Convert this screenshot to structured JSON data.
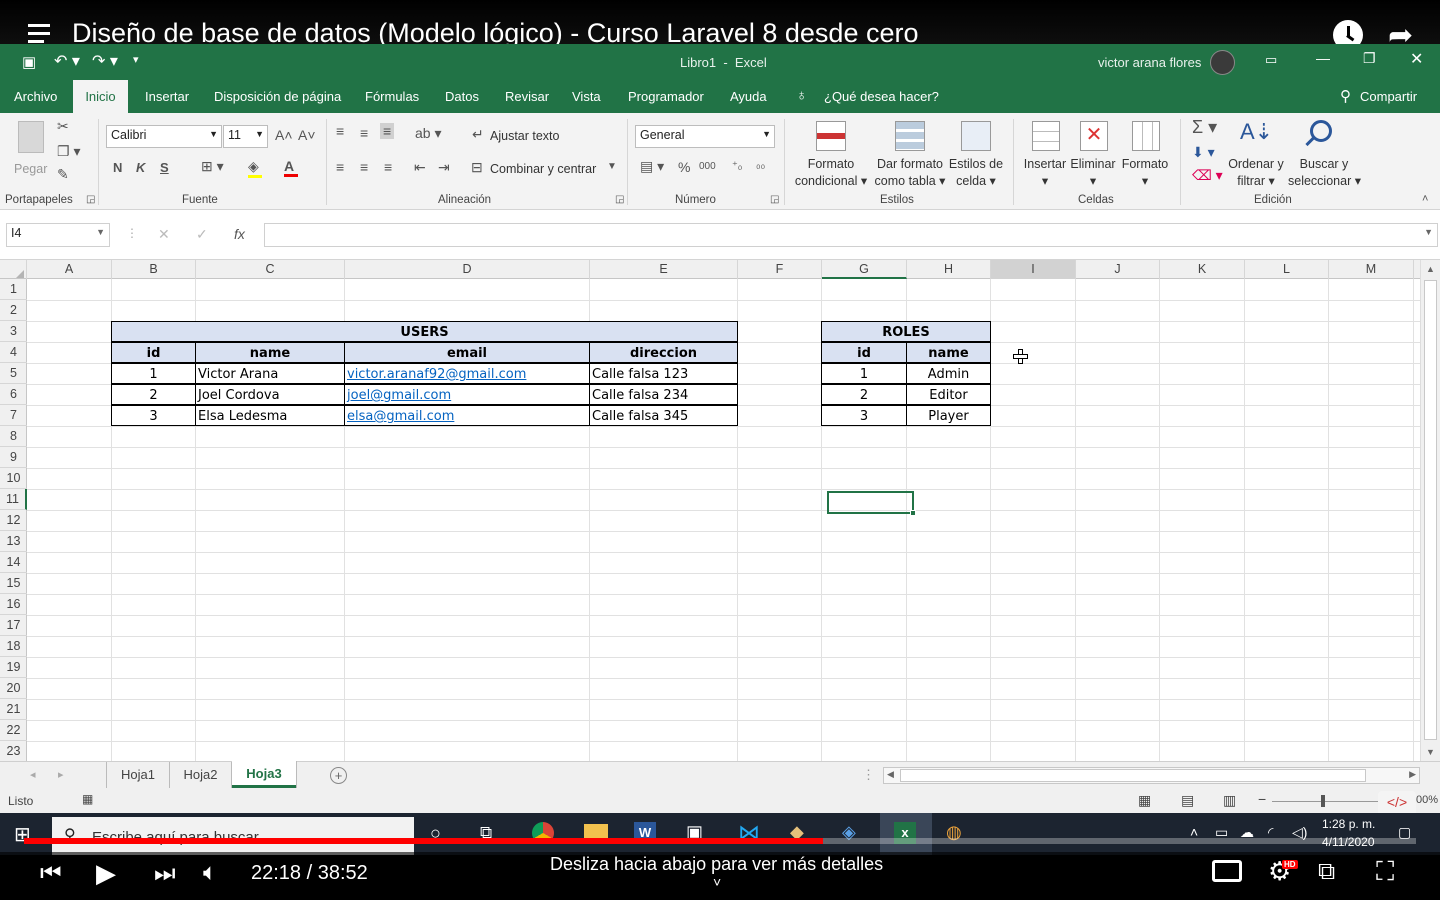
{
  "video": {
    "title": "Diseño de base de datos (Modelo lógico) - Curso Laravel 8 desde cero",
    "time_current": "22:18",
    "time_total": "38:52",
    "time_display": "22:18 / 38:52",
    "hint": "Desliza hacia abajo para ver más detalles",
    "progress": 0.574,
    "hd_badge": "HD"
  },
  "excel": {
    "window_title": "Libro1  -  Excel",
    "user": "victor arana flores",
    "tabs": [
      "Archivo",
      "Inicio",
      "Insertar",
      "Disposición de página",
      "Fórmulas",
      "Datos",
      "Revisar",
      "Vista",
      "Programador",
      "Ayuda"
    ],
    "tell_me": "¿Qué desea hacer?",
    "share": "Compartir",
    "ribbon": {
      "paste": "Pegar",
      "clipboard": "Portapapeles",
      "font_name": "Calibri",
      "font_size": "11",
      "bold": "N",
      "italic": "K",
      "underline": "S",
      "font_group": "Fuente",
      "wrap_text": "Ajustar texto",
      "merge_center": "Combinar y centrar",
      "alignment_group": "Alineación",
      "number_format": "General",
      "percent": "%",
      "thousands": "000",
      "number_group": "Número",
      "cond_format_1": "Formato",
      "cond_format_2": "condicional",
      "table_format_1": "Dar formato",
      "table_format_2": "como tabla",
      "cell_styles_1": "Estilos de",
      "cell_styles_2": "celda",
      "styles_group": "Estilos",
      "insert": "Insertar",
      "delete": "Eliminar",
      "format": "Formato",
      "cells_group": "Celdas",
      "sort_1": "Ordenar y",
      "sort_2": "filtrar",
      "find_1": "Buscar y",
      "find_2": "seleccionar",
      "editing_group": "Edición"
    },
    "name_box": "I4",
    "fx": "fx",
    "columns": [
      "A",
      "B",
      "C",
      "D",
      "E",
      "F",
      "G",
      "H",
      "I",
      "J",
      "K",
      "L",
      "M"
    ],
    "rows": [
      "1",
      "2",
      "3",
      "4",
      "5",
      "6",
      "7",
      "8",
      "9",
      "10",
      "11",
      "12",
      "13",
      "14",
      "15",
      "16",
      "17",
      "18",
      "19",
      "20",
      "21",
      "22",
      "23"
    ],
    "users_table": {
      "title": "USERS",
      "headers": [
        "id",
        "name",
        "email",
        "direccion"
      ],
      "rows": [
        [
          "1",
          "Victor Arana",
          "victor.aranaf92@gmail.com",
          "Calle falsa 123"
        ],
        [
          "2",
          "Joel Cordova",
          "joel@gmail.com",
          "Calle falsa 234"
        ],
        [
          "3",
          "Elsa Ledesma",
          "elsa@gmail.com",
          "Calle falsa 345"
        ]
      ]
    },
    "roles_table": {
      "title": "ROLES",
      "headers": [
        "id",
        "name"
      ],
      "rows": [
        [
          "1",
          "Admin"
        ],
        [
          "2",
          "Editor"
        ],
        [
          "3",
          "Player"
        ]
      ]
    },
    "sheets": [
      "Hoja1",
      "Hoja2",
      "Hoja3"
    ],
    "active_sheet": "Hoja3",
    "status": "Listo",
    "zoom": "00%"
  },
  "taskbar": {
    "search_placeholder": "Escribe aquí para buscar",
    "time": "1:28 p. m.",
    "date": "4/11/2020"
  }
}
